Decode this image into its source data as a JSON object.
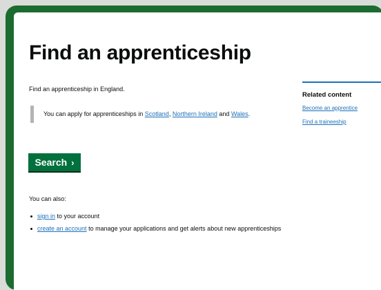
{
  "page": {
    "title": "Find an apprenticeship",
    "lede": "Find an apprenticeship in England.",
    "inset": {
      "text_before": "You can apply for apprenticeships in",
      "links": [
        "Scotland",
        "Northern Ireland",
        "Wales"
      ],
      "sep_comma": ",",
      "sep_and": "and",
      "end": "."
    },
    "search_button": {
      "label": "Search"
    },
    "also_heading": "You can also:",
    "bullets": [
      {
        "link": "sign in",
        "text": "to your account"
      },
      {
        "link": "create an account",
        "text": "to manage your applications and get alerts about new apprenticeships"
      }
    ]
  },
  "related": {
    "heading": "Related content",
    "links": [
      "Become an apprentice",
      "Find a traineeship"
    ]
  },
  "colors": {
    "frame": "#1c6b2f",
    "button": "#00703c",
    "link": "#1d70b8",
    "inset_border": "#b1b4b6"
  }
}
